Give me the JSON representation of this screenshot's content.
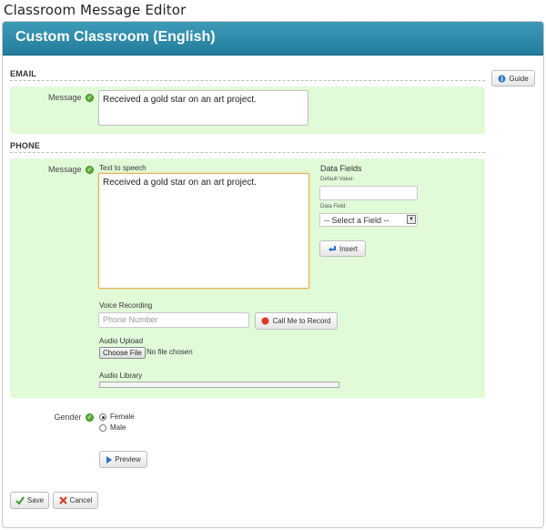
{
  "window": {
    "title": "Classroom Message Editor"
  },
  "panel": {
    "heading": "Custom Classroom (English)"
  },
  "buttons": {
    "guide": "Guide",
    "insert": "Insert",
    "call_me": "Call Me to Record",
    "preview": "Preview",
    "save": "Save",
    "cancel": "Cancel"
  },
  "email": {
    "section_label": "EMAIL",
    "message_label": "Message",
    "message_value": "Received a gold star on an art project."
  },
  "phone": {
    "section_label": "PHONE",
    "message_label": "Message",
    "tts_label": "Text to speech",
    "tts_value": "Received a gold star on an art project.",
    "data_fields": {
      "title": "Data Fields",
      "default_value_label": "Default Value:",
      "default_value": "",
      "data_field_label": "Data Field:",
      "data_field_selected": "-- Select a Field --"
    },
    "voice_recording_label": "Voice Recording",
    "phone_number_placeholder": "Phone Number",
    "audio_upload_label": "Audio Upload",
    "choose_file": "Choose File",
    "no_file": "No file chosen",
    "audio_library_label": "Audio Library"
  },
  "gender": {
    "label": "Gender",
    "options": [
      "Female",
      "Male"
    ],
    "selected": "Female"
  },
  "colors": {
    "header": "#2a86a6",
    "green_bg": "#e1fbd9",
    "focus": "#e4b056"
  }
}
